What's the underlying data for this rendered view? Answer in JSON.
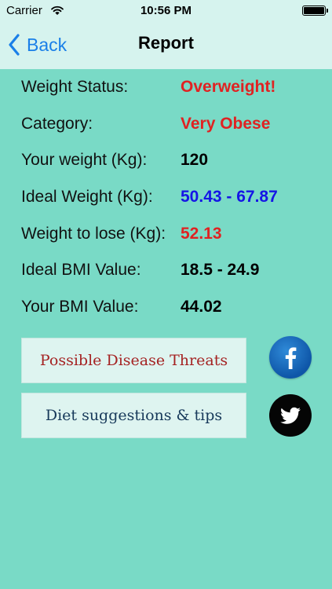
{
  "status_bar": {
    "carrier": "Carrier",
    "time": "10:56 PM"
  },
  "nav": {
    "back_label": "Back",
    "title": "Report"
  },
  "report": [
    {
      "label": "Weight Status:",
      "value": "Overweight!",
      "value_color": "#e02222"
    },
    {
      "label": "Category:",
      "value": "Very Obese",
      "value_color": "#e02222"
    },
    {
      "label": "Your weight (Kg):",
      "value": "120",
      "value_color": "#000000"
    },
    {
      "label": "Ideal Weight (Kg):",
      "value_low": "50.43",
      "separator": " - ",
      "value_high": "67.87",
      "value_color": "#1515e6"
    },
    {
      "label": "Weight to lose (Kg):",
      "value": "52.13",
      "value_color": "#e02222"
    },
    {
      "label": "Ideal BMI Value:",
      "value": "18.5 - 24.9",
      "value_color": "#000000"
    },
    {
      "label": "Your BMI Value:",
      "value": "44.02",
      "value_color": "#000000"
    }
  ],
  "actions": {
    "disease_button": "Possible Disease Threats",
    "diet_button": "Diet suggestions & tips"
  },
  "icons": {
    "wifi": "wifi-icon",
    "battery": "battery-icon",
    "back": "chevron-left-icon",
    "facebook": "facebook-icon",
    "twitter": "twitter-icon"
  },
  "colors": {
    "background": "#79dac6",
    "header": "#d6f3ee",
    "link": "#1a7fe8",
    "facebook": "#1565b6"
  }
}
